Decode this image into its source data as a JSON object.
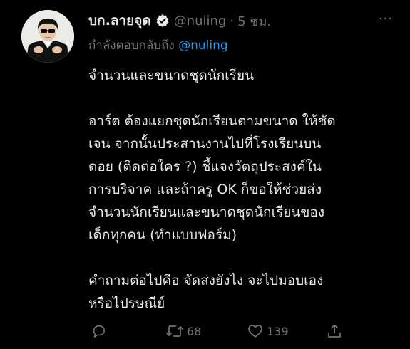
{
  "tweet": {
    "display_name": "บก.ลายจุด",
    "handle": "@nuling",
    "separator": "·",
    "time": "5 ชม.",
    "more": "···",
    "reply_prefix": "กำลังตอบกลับถึง",
    "reply_mention": "@nuling",
    "body": {
      "p1": [
        "จำนวนและขนาดชุดนักเรียน"
      ],
      "p2": [
        "อาร์ต ต้องแยกชุดนักเรียนตามขนาด ให้ชัด",
        "เจน จากนั้นประสานงานไปที่โรงเรียนบน",
        "ดอย (ติดต่อใคร ?) ชี้แจงวัตถุประสงค์ใน",
        "การบริจาค และถ้าครู OK ก็ขอให้ช่วยส่ง",
        "จำนวนนักเรียนและขนาดชุดนักเรียนของ",
        "เด็กทุกคน (ทำแบบฟอร์ม)"
      ],
      "p3": [
        "คำถามต่อไปคือ จัดส่งยังไง จะไปมอบเอง",
        "หรือไปรษณีย์"
      ]
    },
    "actions": {
      "reply": {
        "icon": "reply-icon"
      },
      "retweet": {
        "icon": "retweet-icon",
        "count": "68"
      },
      "like": {
        "icon": "heart-icon",
        "count": "139"
      },
      "share": {
        "icon": "share-icon"
      }
    }
  },
  "colors": {
    "background": "#000000",
    "text": "#e7e9ea",
    "muted": "#71767b",
    "accent": "#1d9bf0"
  }
}
